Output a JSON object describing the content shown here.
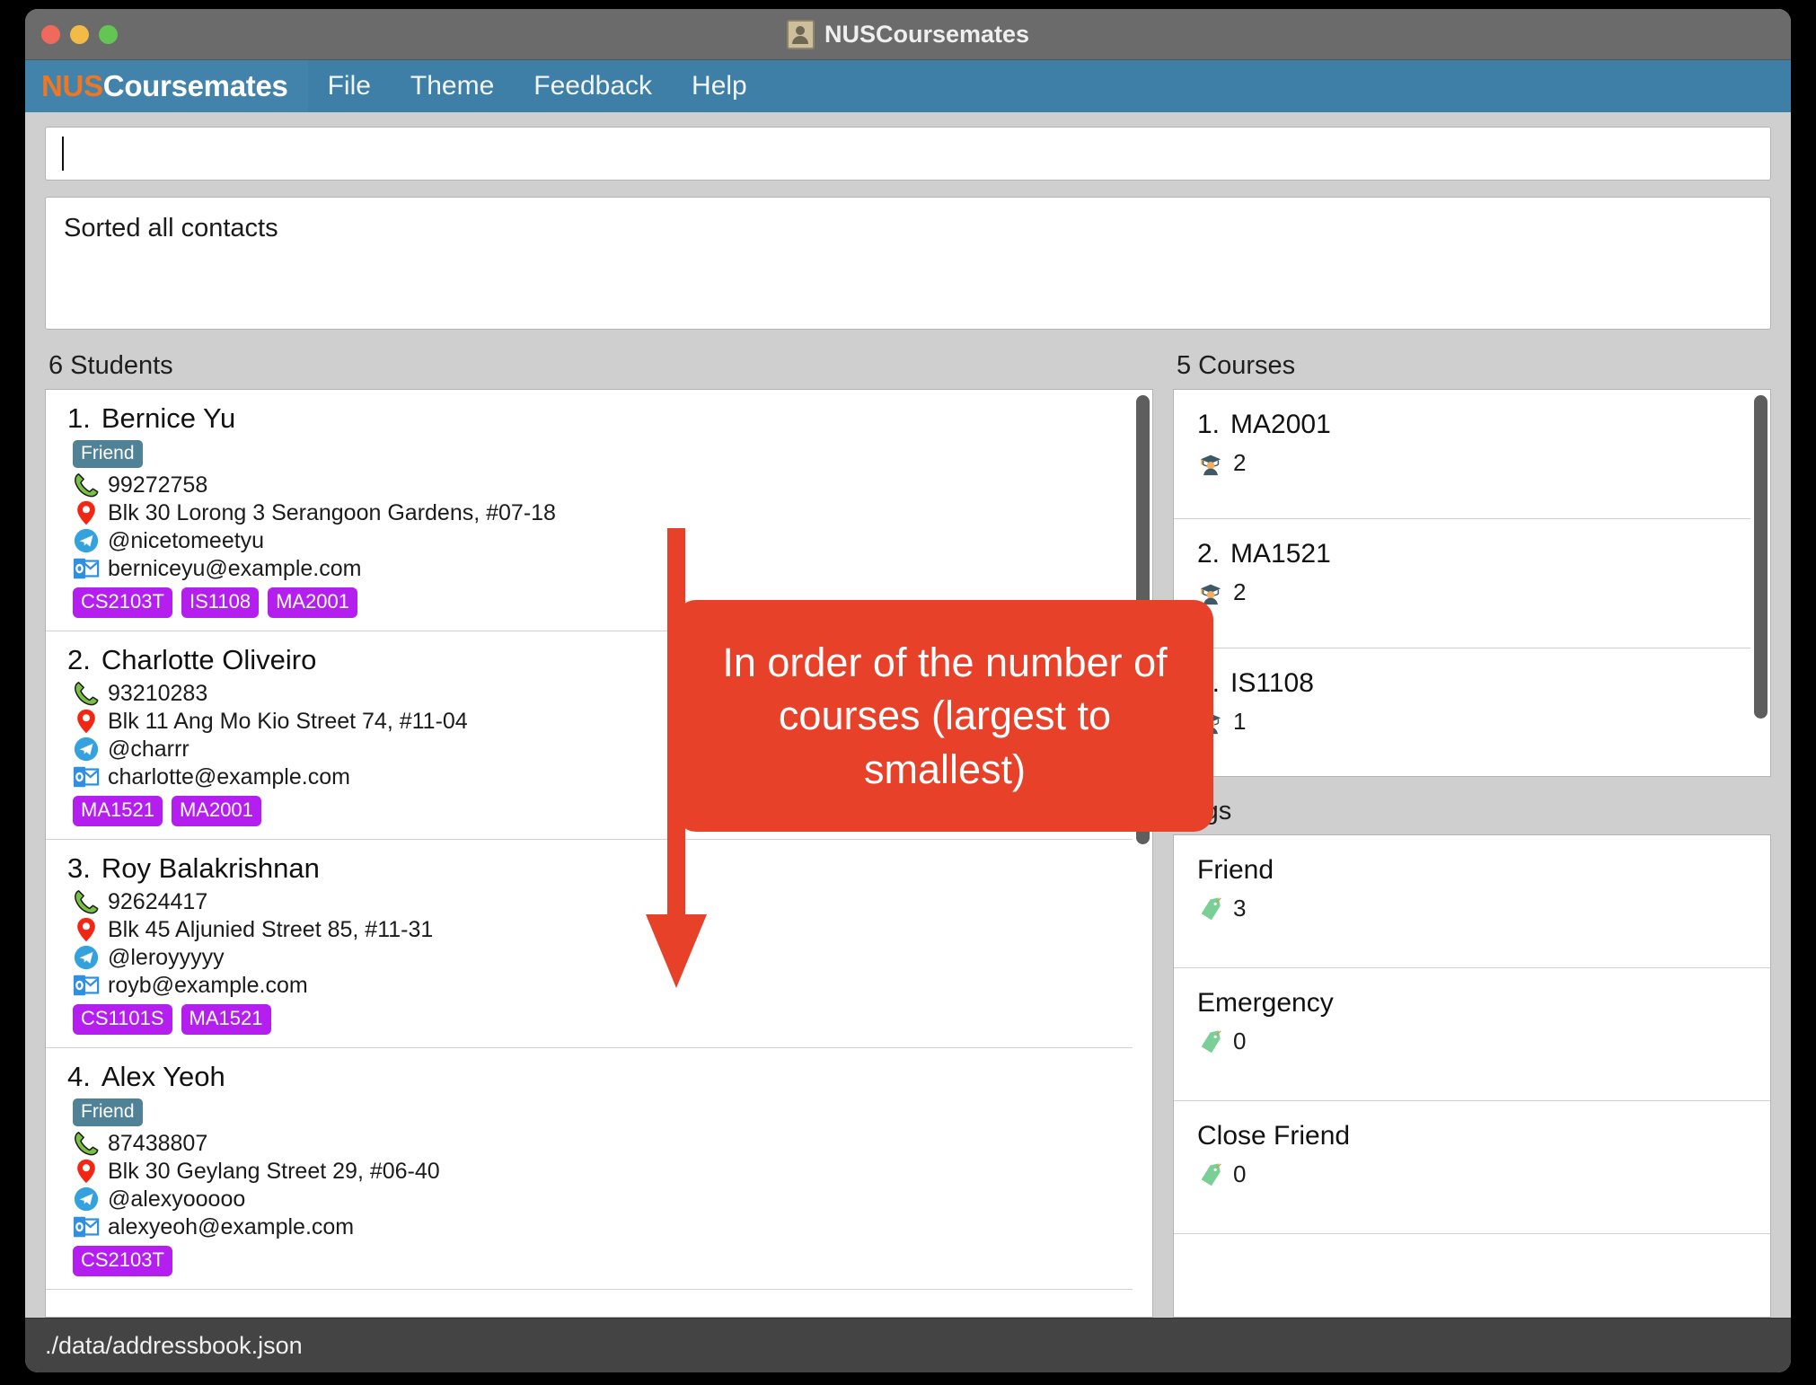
{
  "window": {
    "title": "NUSCoursemates",
    "titlebar_icon": "address-book-icon"
  },
  "menubar": {
    "brand_prefix": "NUS",
    "brand_suffix": "Coursemates",
    "items": [
      {
        "label": "File"
      },
      {
        "label": "Theme"
      },
      {
        "label": "Feedback"
      },
      {
        "label": "Help"
      }
    ]
  },
  "command": {
    "value": "",
    "placeholder": ""
  },
  "result": {
    "message": "Sorted all contacts"
  },
  "students_panel": {
    "label": "6 Students",
    "items": [
      {
        "index": "1.",
        "name": "Bernice Yu",
        "tags": [
          "Friend"
        ],
        "phone": "99272758",
        "address": "Blk 30 Lorong 3 Serangoon Gardens, #07-18",
        "telegram": "@nicetomeetyu",
        "email": "berniceyu@example.com",
        "courses": [
          "CS2103T",
          "IS1108",
          "MA2001"
        ]
      },
      {
        "index": "2.",
        "name": "Charlotte Oliveiro",
        "tags": [],
        "phone": "93210283",
        "address": "Blk 11 Ang Mo Kio Street 74, #11-04",
        "telegram": "@charrr",
        "email": "charlotte@example.com",
        "courses": [
          "MA1521",
          "MA2001"
        ]
      },
      {
        "index": "3.",
        "name": "Roy Balakrishnan",
        "tags": [],
        "phone": "92624417",
        "address": "Blk 45 Aljunied Street 85, #11-31",
        "telegram": "@leroyyyyy",
        "email": "royb@example.com",
        "courses": [
          "CS1101S",
          "MA1521"
        ]
      },
      {
        "index": "4.",
        "name": "Alex Yeoh",
        "tags": [
          "Friend"
        ],
        "phone": "87438807",
        "address": "Blk 30 Geylang Street 29, #06-40",
        "telegram": "@alexyooooo",
        "email": "alexyeoh@example.com",
        "courses": [
          "CS2103T"
        ]
      }
    ]
  },
  "courses_panel": {
    "label": "5 Courses",
    "items": [
      {
        "index": "1.",
        "name": "MA2001",
        "count": "2"
      },
      {
        "index": "2.",
        "name": "MA1521",
        "count": "2"
      },
      {
        "index": "3.",
        "name": "IS1108",
        "count": "1"
      }
    ]
  },
  "tags_panel": {
    "label": "Tags",
    "items": [
      {
        "name": "Friend",
        "count": "3"
      },
      {
        "name": "Emergency",
        "count": "0"
      },
      {
        "name": "Close Friend",
        "count": "0"
      }
    ]
  },
  "statusbar": {
    "path": "./data/addressbook.json"
  },
  "annotation": {
    "callout_text": "In order of the number of courses (largest to smallest)",
    "arrow_direction": "down"
  },
  "colors": {
    "menubar_blue": "#3E7FA8",
    "brand_orange": "#EF7622",
    "course_chip_purple": "#B41FF0",
    "tag_badge_teal": "#4F8296",
    "annotation_red": "#E8412A",
    "statusbar_gray": "#444444",
    "window_gray": "#CFCFCF"
  }
}
